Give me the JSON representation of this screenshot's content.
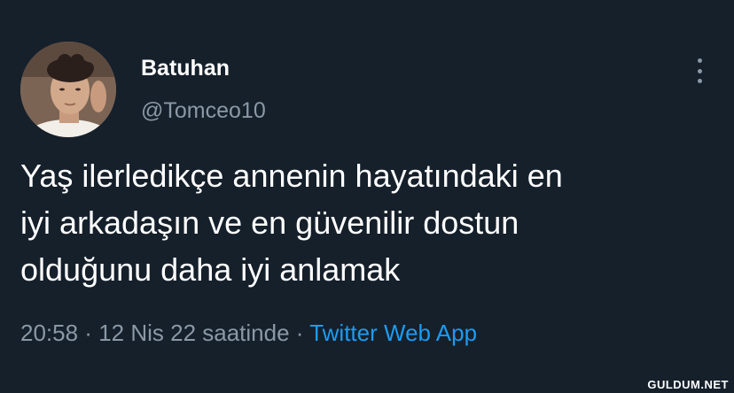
{
  "tweet": {
    "author": {
      "display_name": "Batuhan",
      "handle": "@Tomceo10"
    },
    "text_lines": [
      "Yaş ilerledikçe annenin hayatındaki en",
      "iyi arkadaşın ve en güvenilir dostun",
      "olduğunu daha iyi anlamak"
    ],
    "meta": {
      "time": "20:58",
      "separator": " · ",
      "date": "12 Nis 22 saatinde",
      "source": "Twitter Web App"
    }
  },
  "watermark": "GULDUM.NET",
  "icons": {
    "more": "more-vertical-icon",
    "avatar": "profile-photo"
  },
  "colors": {
    "background": "#15202b",
    "text_primary": "#ffffff",
    "text_secondary": "#8b98a5",
    "link": "#1d9bf0"
  }
}
